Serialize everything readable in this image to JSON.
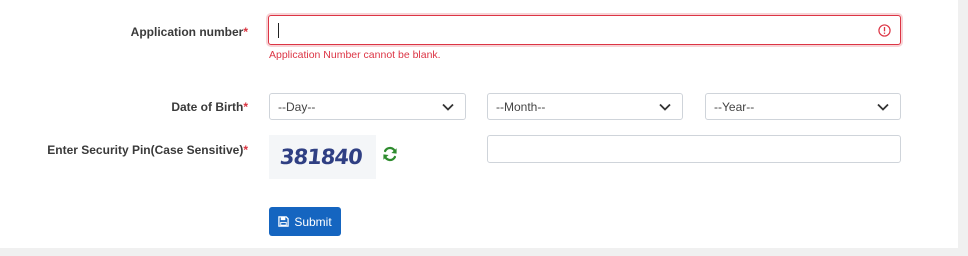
{
  "form": {
    "application_number": {
      "label": "Application number",
      "required_mark": "*",
      "value": "",
      "error": "Application Number cannot be blank."
    },
    "date_of_birth": {
      "label": "Date of Birth",
      "required_mark": "*",
      "day": "--Day--",
      "month": "--Month--",
      "year": "--Year--"
    },
    "security_pin": {
      "label": "Enter Security Pin(Case Sensitive)",
      "required_mark": "*",
      "captcha_text": "381840",
      "value": ""
    },
    "submit_label": "Submit"
  },
  "icons": {
    "error": "error-circle-icon",
    "chevron": "chevron-down-icon",
    "refresh": "refresh-icon",
    "save": "floppy-disk-icon"
  },
  "colors": {
    "error": "#dc3545",
    "primary": "#1565c0",
    "refresh": "#2e8b2e",
    "captcha": "#2f3f83"
  }
}
